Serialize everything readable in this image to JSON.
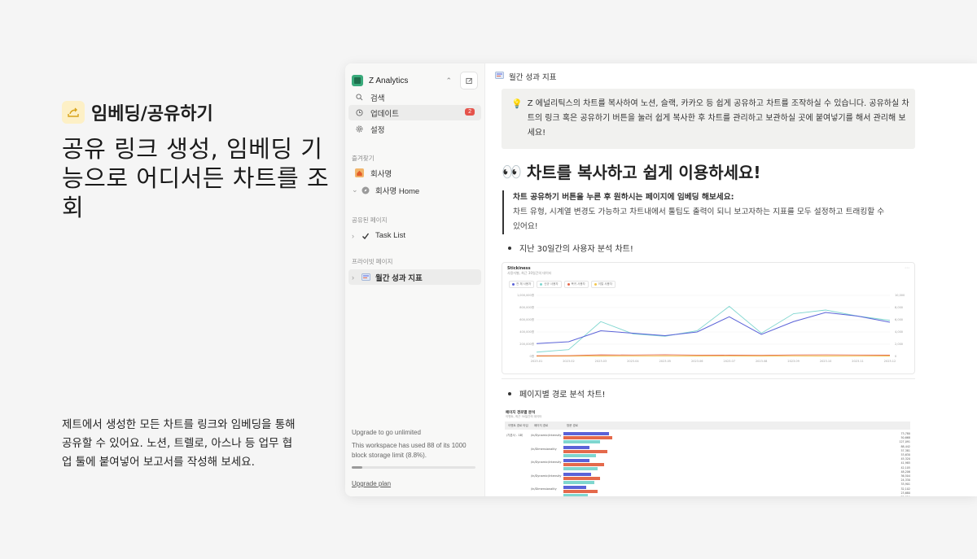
{
  "feature": {
    "label": "임베딩/공유하기",
    "icon": "share-arrow-icon",
    "headline": "공유 링크 생성, 임베딩 기능으로 어디서든 차트를 조회",
    "description": "제트에서 생성한 모든 차트를 링크와 임베딩을 통해 공유할 수 있어요. 노션, 트렐로, 아스나 등 업무 협업 툴에 붙여넣어 보고서를 작성해 보세요."
  },
  "sidebar": {
    "workspace": "Z Analytics",
    "nav": [
      {
        "label": "검색",
        "icon": "search-icon"
      },
      {
        "label": "업데이트",
        "icon": "clock-icon",
        "badge": "2"
      },
      {
        "label": "설정",
        "icon": "gear-icon"
      }
    ],
    "favorites_label": "즐겨찾기",
    "favorites": [
      {
        "label": "회사명",
        "icon": "home-icon"
      },
      {
        "label": "회사명 Home",
        "icon": "compass-icon"
      }
    ],
    "shared_label": "공유된 페이지",
    "shared": [
      {
        "label": "Task List",
        "icon": "check-icon"
      }
    ],
    "private_label": "프라이빗 페이지",
    "private": [
      {
        "label": "월간 성과 지표",
        "icon": "page-icon"
      }
    ],
    "upgrade": {
      "title": "Upgrade to go unlimited",
      "text": "This workspace has used 88 of its 1000 block storage limit (8.8%).",
      "usage_fraction": 0.088,
      "link": "Upgrade plan"
    }
  },
  "content": {
    "breadcrumb": "월간 성과 지표",
    "callout": "Z 에널리틱스의 차트를 복사하여 노션, 슬랙, 카카오 등 쉽게 공유하고 차트를 조작하실 수 있습니다. 공유하실 차트의 링크 혹은 공유하기 버튼을 눌러 쉽게 복사한 후 차트를 관리하고 보관하실 곳에 붙여넣기를 해서 관리해 보세요!",
    "heading_emoji": "👀",
    "heading": "차트를 복사하고 쉽게 이용하세요!",
    "quote_title": "차트 공유하기 버튼을 누른 후 원하시는 페이지에 임베딩 해보세요:",
    "quote_body": "차트 유형, 시계열 변경도 가능하고 차트내에서 툴팁도 출력이 되니 보고자하는 지표를 모두 설정하고 트래킹할 수 있어요!",
    "bullet1": "지난 30일간의 사용자 분석 차트!",
    "bullet2": "페이지별 경로 분석 차트!",
    "embed_chart": {
      "title": "Stickiness",
      "subtitle": "사용자별, 최근 30일간의 데이터",
      "legend": [
        "전 체 사용자",
        "신규 사용자",
        "복귀 사용자",
        "이탈 사용자"
      ],
      "colors": {
        "blue": "#5a62d8",
        "teal": "#7fd6cf",
        "red": "#e4694b",
        "yellow": "#f3c74d"
      }
    },
    "embed_table": {
      "title": "페이지 경로별 분석",
      "subtitle": "이벤트, 최근 30일간의 데이터",
      "headers": [
        "이벤트 경로 타입",
        "페이지 경로",
        "방문 경로"
      ],
      "row_label": "/기본사 - 1회",
      "paths": [
        "/in/Dynamic/Intensity",
        "/in/Dimensionality",
        "/in/Dynamic/Intensity",
        "/in/Dynamic/Intensity",
        "/in/Dimensionality"
      ],
      "values": [
        "73,780",
        "50,668",
        "127,091",
        "88,442",
        "57,381",
        "53,630",
        "45,320",
        "41,985",
        "42,105",
        "48,206",
        "36,504",
        "24,330",
        "33,901",
        "32,102",
        "23,680",
        "22,011"
      ]
    }
  },
  "chart_data": {
    "type": "line",
    "title": "Stickiness",
    "subtitle": "사용자별, 최근 30일간의 데이터",
    "x": [
      "2023.01",
      "2023.02",
      "2023.03",
      "2023.04",
      "2023.05",
      "2023.06",
      "2023.07",
      "2023.08",
      "2023.09",
      "2023.10",
      "2023.11",
      "2023.12"
    ],
    "y_left_ticks": [
      "1,000,000명",
      "800,000명",
      "600,000명",
      "400,000명",
      "200,000명",
      "0명"
    ],
    "y_right_ticks": [
      "10,000",
      "8,000",
      "6,000",
      "4,000",
      "2,000",
      "0"
    ],
    "series": [
      {
        "name": "전 체 사용자",
        "color": "#5a62d8",
        "values": [
          210000,
          240000,
          420000,
          380000,
          340000,
          400000,
          650000,
          360000,
          570000,
          720000,
          660000,
          560000
        ]
      },
      {
        "name": "신규 사용자",
        "color": "#7fd6cf",
        "values": [
          70000,
          110000,
          570000,
          370000,
          330000,
          420000,
          820000,
          380000,
          700000,
          760000,
          660000,
          590000
        ]
      },
      {
        "name": "복귀 사용자",
        "color": "#e4694b",
        "values": [
          10000,
          12000,
          25000,
          22000,
          28000,
          21000,
          20000,
          18000,
          24000,
          26000,
          22000,
          20000
        ]
      },
      {
        "name": "이탈 사용자",
        "color": "#f3c74d",
        "values": [
          3000,
          4000,
          5000,
          4000,
          6000,
          5000,
          4000,
          5000,
          6000,
          5000,
          4000,
          5000
        ]
      }
    ],
    "ylim": [
      0,
      1000000
    ],
    "grid": true,
    "legend_position": "top-left"
  }
}
